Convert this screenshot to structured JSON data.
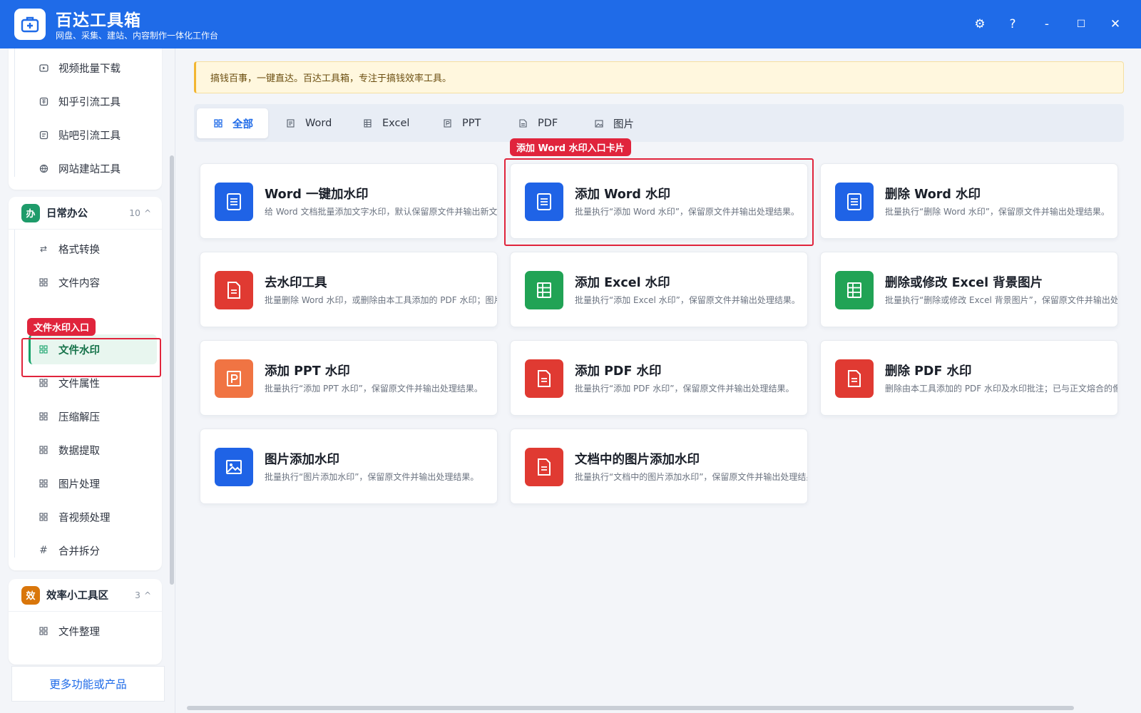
{
  "app": {
    "title": "百达工具箱",
    "subtitle": "网盘、采集、建站、内容制作一体化工作台",
    "window_controls": [
      "⚙",
      "?",
      "-",
      "☐",
      "✕"
    ]
  },
  "sidebar": {
    "top_items": [
      {
        "label": "视频批量下载",
        "icon": "video-icon"
      },
      {
        "label": "知乎引流工具",
        "icon": "zhihu-icon"
      },
      {
        "label": "贴吧引流工具",
        "icon": "tieba-icon"
      },
      {
        "label": "网站建站工具",
        "icon": "globe-icon"
      }
    ],
    "group_office": {
      "badge": "办",
      "badge_color": "#1e9b6a",
      "title": "日常办公",
      "count": "10",
      "caret": "^",
      "items": [
        {
          "label": "格式转换",
          "icon": "swap-icon"
        },
        {
          "label": "文件内容",
          "icon": "grid-icon"
        },
        {
          "label": "文件水印",
          "icon": "grid-icon",
          "active": true
        },
        {
          "label": "文件属性",
          "icon": "grid-icon"
        },
        {
          "label": "压缩解压",
          "icon": "grid-icon"
        },
        {
          "label": "数据提取",
          "icon": "grid-icon"
        },
        {
          "label": "图片处理",
          "icon": "grid-icon"
        },
        {
          "label": "音视频处理",
          "icon": "grid-icon"
        },
        {
          "label": "合并拆分",
          "icon": "hash-icon"
        }
      ]
    },
    "group_efficiency": {
      "badge": "效",
      "badge_color": "#d9760b",
      "title": "效率小工具区",
      "count": "3",
      "caret": "^",
      "items": [
        {
          "label": "文件整理",
          "icon": "grid-icon"
        }
      ]
    },
    "footer_label": "更多功能或产品"
  },
  "annotations": {
    "sidebar_tag": "文件水印入口",
    "card_tag": "添加 Word 水印入口卡片",
    "color": "#e0243c"
  },
  "notice": "搞钱百事，一键直达。百达工具箱，专注于搞钱效率工具。",
  "tabs": [
    {
      "label": "全部",
      "icon": "grid-icon",
      "active": true
    },
    {
      "label": "Word",
      "icon": "doc-icon"
    },
    {
      "label": "Excel",
      "icon": "table-icon"
    },
    {
      "label": "PPT",
      "icon": "ppt-icon"
    },
    {
      "label": "PDF",
      "icon": "pdf-icon"
    },
    {
      "label": "图片",
      "icon": "image-icon"
    }
  ],
  "cards": [
    {
      "title": "Word 一键加水印",
      "desc": "给 Word 文档批量添加文字水印，默认保留原文件并输出新文件。",
      "icon": "word-doc-icon",
      "color": "#1f63e6"
    },
    {
      "title": "添加 Word 水印",
      "desc": "批量执行“添加 Word 水印”，保留原文件并输出处理结果。",
      "icon": "word-doc-icon",
      "color": "#1f63e6"
    },
    {
      "title": "删除 Word 水印",
      "desc": "批量执行“删除 Word 水印”，保留原文件并输出处理结果。",
      "icon": "word-doc-icon",
      "color": "#1f63e6"
    },
    {
      "title": "去水印工具",
      "desc": "批量删除 Word 水印，或删除由本工具添加的 PDF 水印；图片/视频",
      "icon": "file-icon",
      "color": "#e03a32"
    },
    {
      "title": "添加 Excel 水印",
      "desc": "批量执行“添加 Excel 水印”，保留原文件并输出处理结果。",
      "icon": "sheet-icon",
      "color": "#21a355"
    },
    {
      "title": "删除或修改 Excel 背景图片",
      "desc": "批量执行“删除或修改 Excel 背景图片”，保留原文件并输出处理结果。",
      "icon": "sheet-icon",
      "color": "#21a355"
    },
    {
      "title": "添加 PPT 水印",
      "desc": "批量执行“添加 PPT 水印”，保留原文件并输出处理结果。",
      "icon": "ppt-file-icon",
      "color": "#f07443"
    },
    {
      "title": "添加 PDF 水印",
      "desc": "批量执行“添加 PDF 水印”，保留原文件并输出处理结果。",
      "icon": "file-icon",
      "color": "#e03a32"
    },
    {
      "title": "删除 PDF 水印",
      "desc": "删除由本工具添加的 PDF 水印及水印批注；已与正文熔合的像素水印",
      "icon": "file-icon",
      "color": "#e03a32"
    },
    {
      "title": "图片添加水印",
      "desc": "批量执行“图片添加水印”，保留原文件并输出处理结果。",
      "icon": "image-file-icon",
      "color": "#1f63e6"
    },
    {
      "title": "文档中的图片添加水印",
      "desc": "批量执行“文档中的图片添加水印”，保留原文件并输出处理结果。",
      "icon": "file-icon",
      "color": "#e03a32"
    }
  ]
}
